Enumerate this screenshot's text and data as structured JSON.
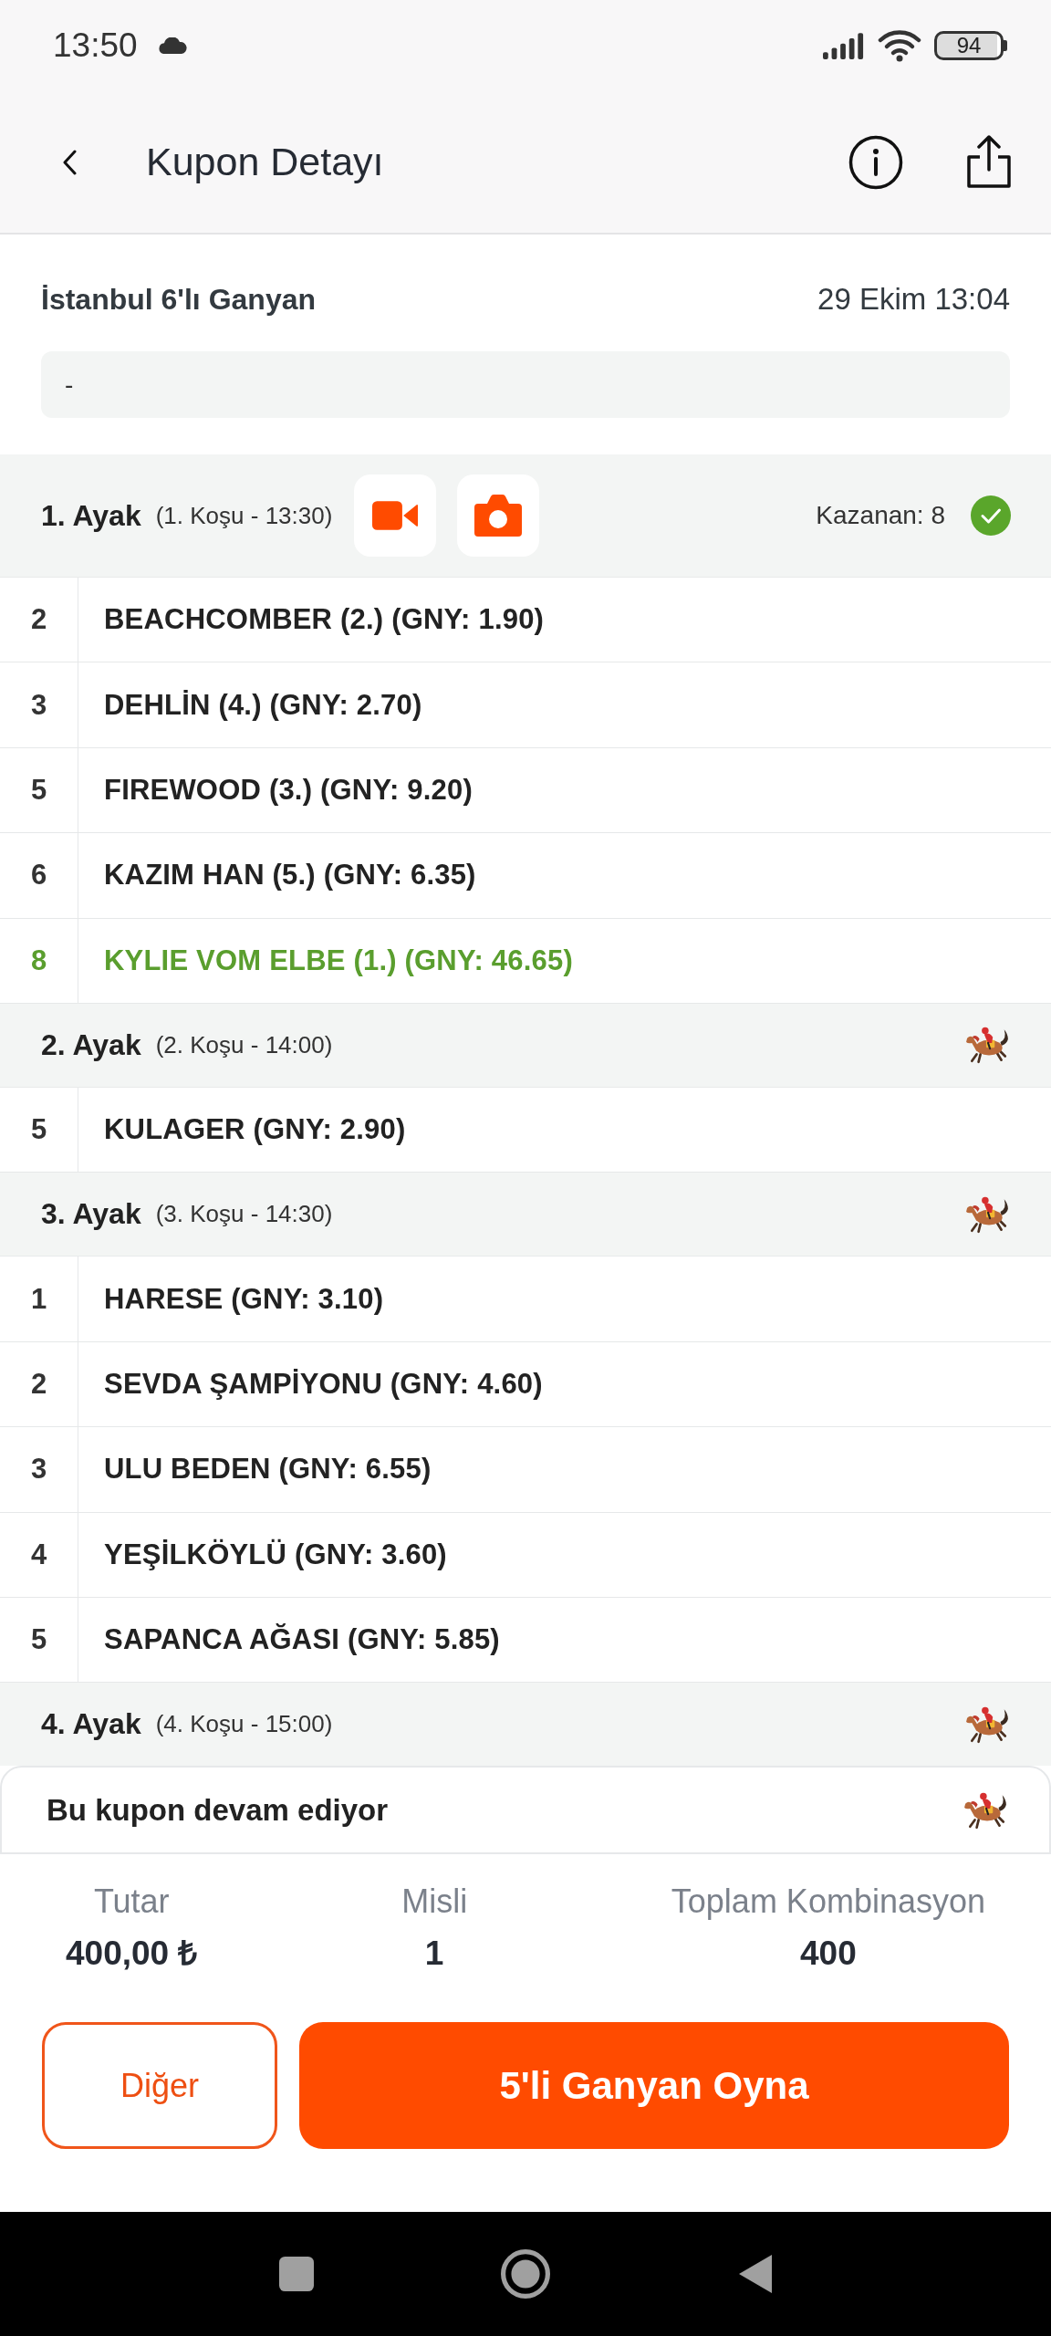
{
  "status_bar": {
    "time": "13:50",
    "battery": "94"
  },
  "header": {
    "title": "Kupon Detayı"
  },
  "coupon": {
    "name": "İstanbul 6'lı Ganyan",
    "date": "29 Ekim 13:04",
    "note": "-"
  },
  "legs": [
    {
      "title": "1. Ayak",
      "race": "(1. Koşu - 13:30)",
      "finished": true,
      "winner": "Kazanan: 8",
      "horses": [
        {
          "number": "2",
          "name": "BEACHCOMBER (2.) (GNY: 1.90)",
          "won": false
        },
        {
          "number": "3",
          "name": "DEHLİN (4.) (GNY: 2.70)",
          "won": false
        },
        {
          "number": "5",
          "name": "FIREWOOD (3.) (GNY: 9.20)",
          "won": false
        },
        {
          "number": "6",
          "name": "KAZIM HAN (5.) (GNY: 6.35)",
          "won": false
        },
        {
          "number": "8",
          "name": "KYLIE VOM ELBE (1.) (GNY: 46.65)",
          "won": true
        }
      ]
    },
    {
      "title": "2. Ayak",
      "race": "(2. Koşu - 14:00)",
      "finished": false,
      "horses": [
        {
          "number": "5",
          "name": "KULAGER (GNY: 2.90)",
          "won": false
        }
      ]
    },
    {
      "title": "3. Ayak",
      "race": "(3. Koşu - 14:30)",
      "finished": false,
      "horses": [
        {
          "number": "1",
          "name": "HARESE (GNY: 3.10)",
          "won": false
        },
        {
          "number": "2",
          "name": "SEVDA ŞAMPİYONU (GNY: 4.60)",
          "won": false
        },
        {
          "number": "3",
          "name": "ULU BEDEN (GNY: 6.55)",
          "won": false
        },
        {
          "number": "4",
          "name": "YEŞİLKÖYLÜ (GNY: 3.60)",
          "won": false
        },
        {
          "number": "5",
          "name": "SAPANCA AĞASI (GNY: 5.85)",
          "won": false
        }
      ]
    },
    {
      "title": "4. Ayak",
      "race": "(4. Koşu - 15:00)",
      "finished": false
    }
  ],
  "status_card": {
    "text": "Bu kupon devam ediyor"
  },
  "summary": [
    {
      "label": "Tutar",
      "value": "400,00 ₺"
    },
    {
      "label": "Misli",
      "value": "1"
    },
    {
      "label": "Toplam Kombinasyon",
      "value": "400"
    }
  ],
  "buttons": [
    {
      "label": "Diğer",
      "kind": "secondary"
    },
    {
      "label": "5'li Ganyan Oyna",
      "kind": "primary"
    }
  ]
}
